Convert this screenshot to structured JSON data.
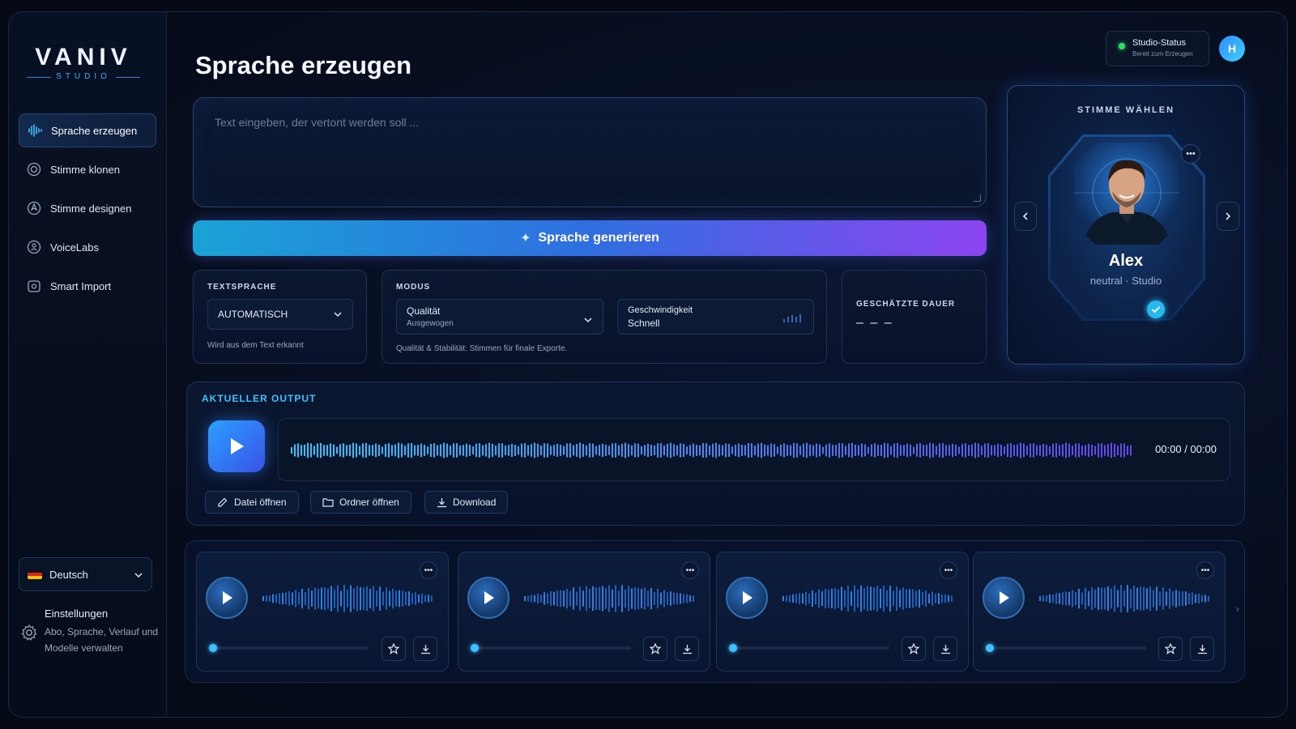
{
  "brand": {
    "name": "VANIV",
    "sub": "STUDIO"
  },
  "sidebar": {
    "items": [
      {
        "label": "Sprache erzeugen",
        "icon": "waveform-icon",
        "active": true
      },
      {
        "label": "Stimme klonen",
        "icon": "clone-icon"
      },
      {
        "label": "Stimme designen",
        "icon": "design-icon"
      },
      {
        "label": "VoiceLabs",
        "icon": "lab-icon"
      },
      {
        "label": "Smart Import",
        "icon": "import-icon"
      }
    ],
    "language": "Deutsch",
    "settings": {
      "title": "Einstellungen",
      "desc": "Abo, Sprache, Verlauf und Modelle verwalten"
    }
  },
  "header": {
    "title": "Sprache erzeugen",
    "status_title": "Studio-Status",
    "status_sub": "Bereit zum Erzeugen",
    "avatar_initial": "H"
  },
  "input": {
    "placeholder": "Text eingeben, der vertont werden soll ..."
  },
  "generate_label": "Sprache generieren",
  "textsprache": {
    "label": "TEXTSPRACHE",
    "value": "AUTOMATISCH",
    "hint": "Wird aus dem Text erkannt"
  },
  "modus": {
    "label": "MODUS",
    "quality_label": "Qualität",
    "quality_value": "Ausgewogen",
    "speed_label": "Geschwindigkeit",
    "speed_value": "Schnell",
    "hint": "Qualität & Stabilität: Stimmen für finale Exporte."
  },
  "duration": {
    "label": "GESCHÄTZTE DAUER",
    "value": "– – –"
  },
  "voice": {
    "title": "STIMME WÄHLEN",
    "name": "Alex",
    "desc": "neutral · Studio"
  },
  "output": {
    "title": "AKTUELLER OUTPUT",
    "time": "00:00 / 00:00",
    "buttons": {
      "open_file": "Datei öffnen",
      "open_folder": "Ordner öffnen",
      "download": "Download"
    }
  },
  "history_count": 4,
  "colors": {
    "accent": "#3fc1ff",
    "gradient_start": "#1aa3d6",
    "gradient_end": "#8c44f0",
    "status": "#2ee06b"
  }
}
